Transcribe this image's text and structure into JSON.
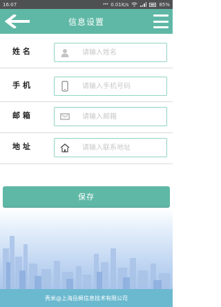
{
  "status_bar": {
    "time": "16:07",
    "network_speed": "0.01K/s",
    "battery": "85%",
    "icons": [
      "more-dots-icon",
      "wifi-icon",
      "signal-icon",
      "battery-icon"
    ]
  },
  "header": {
    "title": "信息设置",
    "back_icon": "arrow-left-icon",
    "menu_icon": "menu-icon"
  },
  "form": {
    "fields": [
      {
        "label": "姓 名",
        "icon": "user-icon",
        "placeholder": "请输入姓名",
        "value": ""
      },
      {
        "label": "手 机",
        "icon": "phone-icon",
        "placeholder": "请输入手机号码",
        "value": ""
      },
      {
        "label": "邮 箱",
        "icon": "mail-icon",
        "placeholder": "请输入邮箱",
        "value": ""
      },
      {
        "label": "地 址",
        "icon": "home-icon",
        "placeholder": "请输入联系地址",
        "value": ""
      }
    ]
  },
  "actions": {
    "save_label": "保存"
  },
  "footer": {
    "text": "秀米@上海岳枫信息技术有限公司"
  },
  "colors": {
    "primary": "#5fb8a6",
    "input_border": "#8fd4c3",
    "footer": "#6bb9cf",
    "status_bar": "#4e5152"
  }
}
